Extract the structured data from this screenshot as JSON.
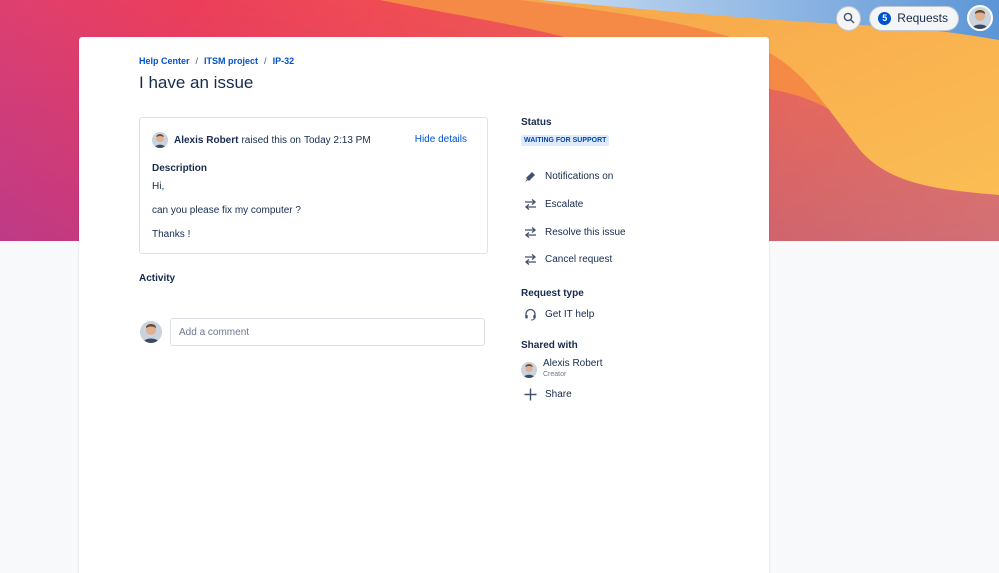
{
  "header": {
    "search_label": "Search",
    "requests_count": "5",
    "requests_label": "Requests"
  },
  "breadcrumb": {
    "items": [
      "Help Center",
      "ITSM project",
      "IP-32"
    ],
    "separator": "/"
  },
  "issue": {
    "title": "I have an issue",
    "reporter": "Alexis Robert",
    "raised_text": "raised this on",
    "raised_time": "Today 2:13 PM",
    "hide_details": "Hide details",
    "description_heading": "Description",
    "description_lines": [
      "Hi,",
      "can you please fix my computer ?",
      "Thanks !"
    ]
  },
  "activity": {
    "heading": "Activity",
    "comment_placeholder": "Add a comment"
  },
  "sidebar": {
    "status_heading": "Status",
    "status_value": "WAITING FOR SUPPORT",
    "actions": [
      {
        "label": "Notifications on",
        "icon": "megaphone-icon"
      },
      {
        "label": "Escalate",
        "icon": "transition-icon"
      },
      {
        "label": "Resolve this issue",
        "icon": "transition-icon"
      },
      {
        "label": "Cancel request",
        "icon": "transition-icon"
      }
    ],
    "request_type_heading": "Request type",
    "request_type_value": "Get IT help",
    "shared_heading": "Shared with",
    "shared_name": "Alexis Robert",
    "shared_role": "Creator",
    "share_label": "Share"
  },
  "colors": {
    "link": "#0052cc",
    "text": "#172b4d",
    "lozenge_bg": "#deebff",
    "lozenge_text": "#0747a6"
  }
}
